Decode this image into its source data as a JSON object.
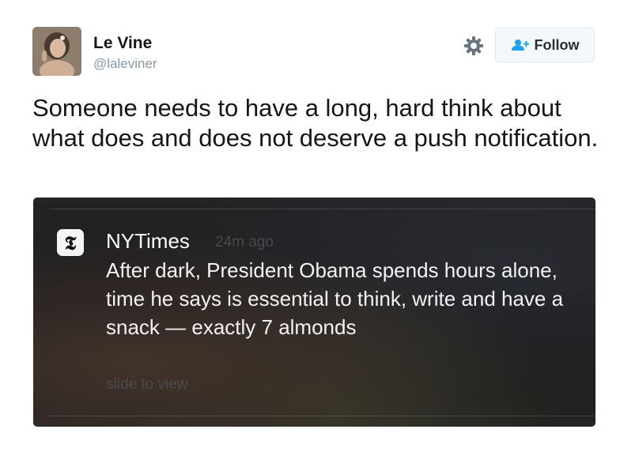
{
  "tweet": {
    "author": {
      "display_name": "Le Vine",
      "handle": "@laleviner"
    },
    "actions": {
      "settings_icon": "gear-icon",
      "follow_label": "Follow",
      "follow_icon": "add-user-icon"
    },
    "text": "Someone needs to have a long, hard think about what does and does not deserve a push notification."
  },
  "notification": {
    "app_icon_glyph": "𝕿",
    "app_name": "NYTimes",
    "time": "24m ago",
    "message": "After dark, President Obama spends hours alone, time he says is essential to think, write and have a snack — exactly 7 almonds",
    "hint": "slide to view"
  },
  "colors": {
    "follow_icon_blue": "#1da1f2",
    "handle_gray": "#8899a6",
    "notification_dim_text": "#4a4a4c"
  }
}
